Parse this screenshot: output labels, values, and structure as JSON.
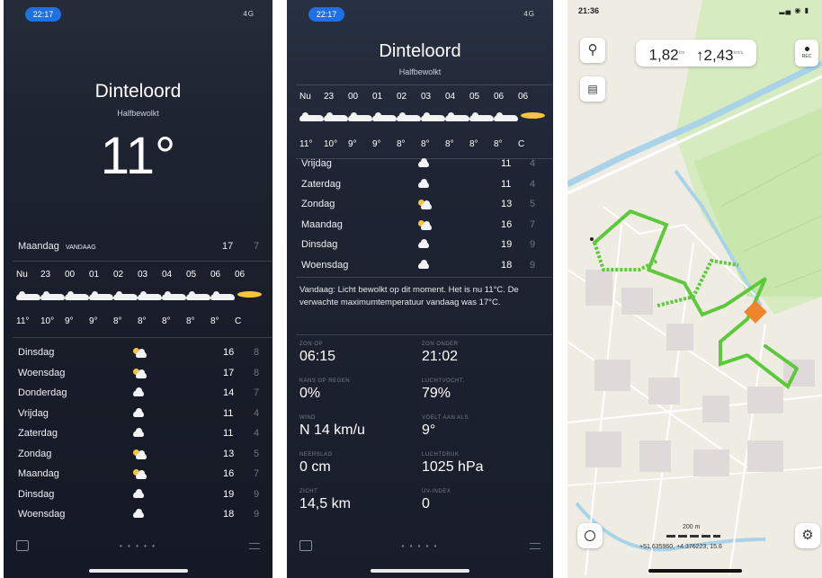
{
  "screen1": {
    "time": "22:17",
    "signal": "4G",
    "city": "Dinteloord",
    "condition": "Halfbewolkt",
    "temperature": "11°",
    "today": {
      "label": "Maandag",
      "badge": "VANDAAG",
      "hi": "17",
      "lo": "7"
    },
    "hours": [
      "Nu",
      "23",
      "00",
      "01",
      "02",
      "03",
      "04",
      "05",
      "06",
      "06"
    ],
    "hour_icons": [
      "cloud",
      "cloud",
      "cloud",
      "cloud",
      "cloud",
      "cloud",
      "cloud",
      "cloud",
      "cloud",
      "sun"
    ],
    "hour_temps": [
      "11°",
      "10°",
      "9°",
      "9°",
      "8°",
      "8°",
      "8°",
      "8°",
      "8°",
      "C"
    ],
    "days": [
      {
        "name": "Dinsdag",
        "icon": "sun-cloud",
        "hi": "16",
        "lo": "8"
      },
      {
        "name": "Woensdag",
        "icon": "sun-cloud",
        "hi": "17",
        "lo": "8"
      },
      {
        "name": "Donderdag",
        "icon": "cloud",
        "hi": "14",
        "lo": "7"
      },
      {
        "name": "Vrijdag",
        "icon": "cloud",
        "hi": "11",
        "lo": "4"
      },
      {
        "name": "Zaterdag",
        "icon": "cloud",
        "hi": "11",
        "lo": "4"
      },
      {
        "name": "Zondag",
        "icon": "sun-cloud",
        "hi": "13",
        "lo": "5"
      },
      {
        "name": "Maandag",
        "icon": "sun-cloud",
        "hi": "16",
        "lo": "7"
      },
      {
        "name": "Dinsdag",
        "icon": "cloud",
        "hi": "19",
        "lo": "9"
      },
      {
        "name": "Woensdag",
        "icon": "cloud",
        "hi": "18",
        "lo": "9"
      }
    ],
    "page_dots": "• • • • •"
  },
  "screen2": {
    "time": "22:17",
    "signal": "4G",
    "city": "Dinteloord",
    "condition": "Halfbewolkt",
    "hours": [
      "Nu",
      "23",
      "00",
      "01",
      "02",
      "03",
      "04",
      "05",
      "06",
      "06"
    ],
    "hour_temps": [
      "11°",
      "10°",
      "9°",
      "9°",
      "8°",
      "8°",
      "8°",
      "8°",
      "8°",
      "C"
    ],
    "days": [
      {
        "name": "Vrijdag",
        "icon": "cloud",
        "hi": "11",
        "lo": "4"
      },
      {
        "name": "Zaterdag",
        "icon": "cloud",
        "hi": "11",
        "lo": "4"
      },
      {
        "name": "Zondag",
        "icon": "sun-cloud",
        "hi": "13",
        "lo": "5"
      },
      {
        "name": "Maandag",
        "icon": "sun-cloud",
        "hi": "16",
        "lo": "7"
      },
      {
        "name": "Dinsdag",
        "icon": "cloud",
        "hi": "19",
        "lo": "9"
      },
      {
        "name": "Woensdag",
        "icon": "cloud",
        "hi": "18",
        "lo": "9"
      }
    ],
    "summary": "Vandaag: Licht bewolkt op dit moment. Het is nu 11°C. De verwachte maximumtemperatuur vandaag was 17°C.",
    "details": [
      {
        "label": "ZON OP",
        "value": "06:15"
      },
      {
        "label": "ZON ONDER",
        "value": "21:02"
      },
      {
        "label": "KANS OP REGEN",
        "value": "0%"
      },
      {
        "label": "LUCHTVOCHT.",
        "value": "79%"
      },
      {
        "label": "WIND",
        "value": "N 14 km/u"
      },
      {
        "label": "VOELT AAN ALS",
        "value": "9°"
      },
      {
        "label": "NEERSLAG",
        "value": "0 cm"
      },
      {
        "label": "LUCHTDRUK",
        "value": "1025 hPa"
      },
      {
        "label": "ZICHT",
        "value": "14,5 km"
      },
      {
        "label": "UV-INDEX",
        "value": "0"
      }
    ],
    "page_dots": "• • • • •"
  },
  "screen3": {
    "time": "21:36",
    "distance": "1,82",
    "distance_unit": "km",
    "ascent": "↑2,43",
    "ascent_unit": "km/u",
    "rec_label": "REC",
    "scale_label": "200 m",
    "coordinates": "+51.635960, +4.376223, 15.6",
    "colors": {
      "route": "#5cc93a",
      "marker": "#f0842a",
      "water": "#a9d3e8",
      "park": "#cfe8b4",
      "built": "#e0d9d9"
    }
  }
}
